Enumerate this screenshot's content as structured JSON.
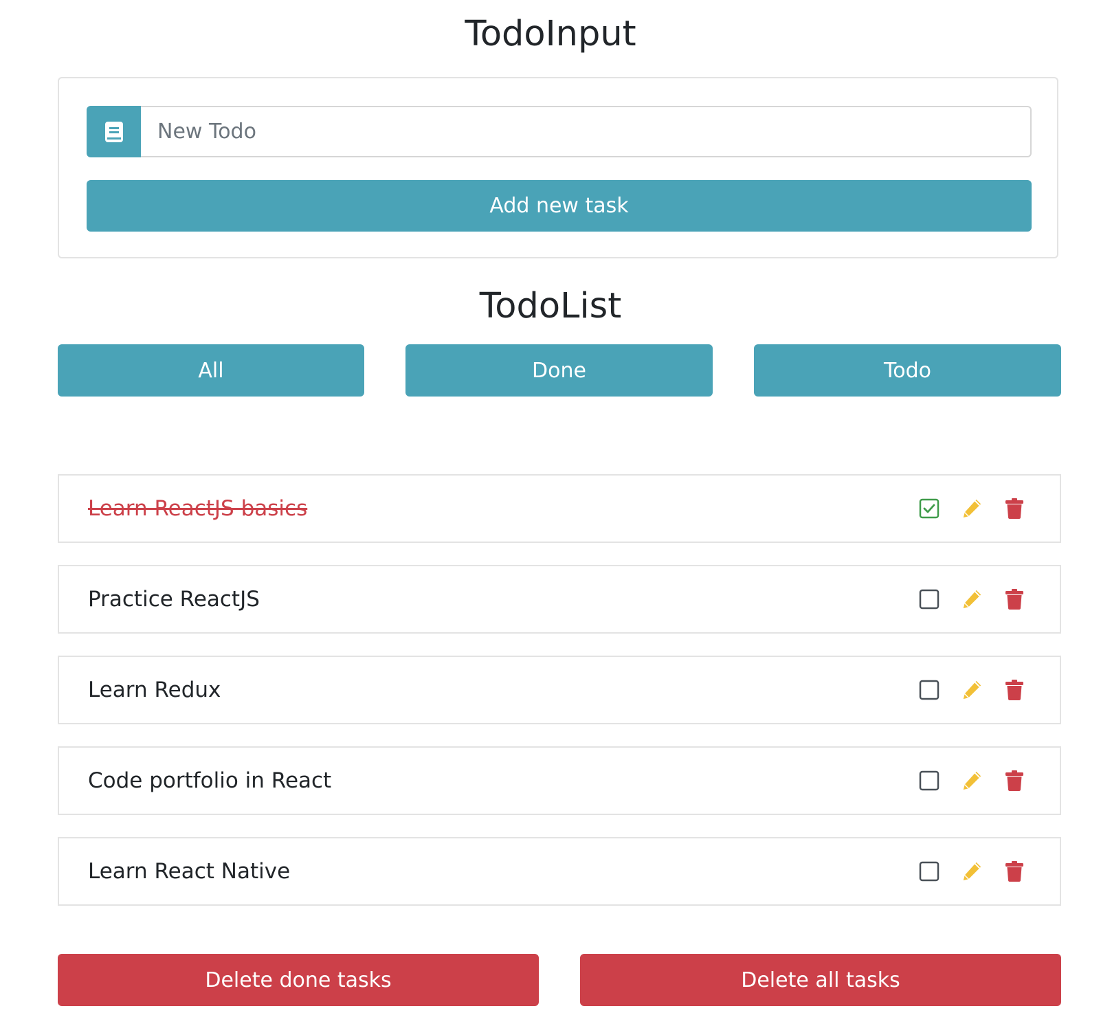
{
  "colors": {
    "primary": "#4aa3b7",
    "danger": "#cc4049",
    "success": "#3f9b4a",
    "warning": "#f2c037",
    "border": "#e3e3e3"
  },
  "input_section": {
    "title": "TodoInput",
    "prepend_icon": "book-icon",
    "placeholder": "New Todo",
    "value": "",
    "add_button_label": "Add new task"
  },
  "list_section": {
    "title": "TodoList",
    "filters": [
      {
        "label": "All"
      },
      {
        "label": "Done"
      },
      {
        "label": "Todo"
      }
    ],
    "items": [
      {
        "text": "Learn ReactJS basics",
        "done": true
      },
      {
        "text": "Practice ReactJS",
        "done": false
      },
      {
        "text": "Learn Redux",
        "done": false
      },
      {
        "text": "Code portfolio in React",
        "done": false
      },
      {
        "text": "Learn React Native",
        "done": false
      }
    ],
    "item_icons": [
      "checkbox-icon",
      "pencil-icon",
      "trash-icon"
    ]
  },
  "footer": {
    "delete_done_label": "Delete done tasks",
    "delete_all_label": "Delete all tasks"
  }
}
